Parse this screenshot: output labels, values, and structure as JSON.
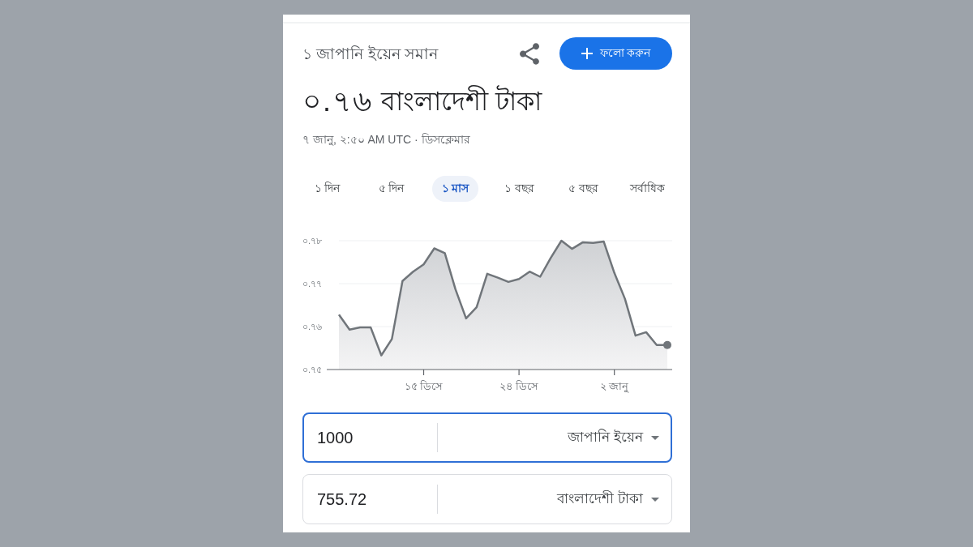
{
  "header": {
    "subtitle": "১ জাপানি ইয়েন সমান",
    "follow_button": {
      "label": "ফলো করুন"
    }
  },
  "rate": {
    "value": "০.৭৬",
    "currency": "বাংলাদেশী টাকা"
  },
  "timestamp": "৭ জানু, ২:৫০ AM UTC ·",
  "disclaimer_link": "ডিসক্লেমার",
  "tabs": [
    {
      "label": "১ দিন",
      "selected": false
    },
    {
      "label": "৫ দিন",
      "selected": false
    },
    {
      "label": "১ মাস",
      "selected": true
    },
    {
      "label": "১ বছর",
      "selected": false
    },
    {
      "label": "৫ বছর",
      "selected": false
    },
    {
      "label": "সর্বাধিক",
      "selected": false
    }
  ],
  "chart_data": {
    "type": "area",
    "categories": [
      null,
      null,
      null,
      null,
      null,
      null,
      null,
      null,
      "১৫ ডিসে",
      null,
      null,
      null,
      null,
      null,
      null,
      null,
      null,
      "২৪ ডিসে",
      null,
      null,
      null,
      null,
      null,
      null,
      null,
      null,
      "২ জানু",
      null,
      null,
      null,
      null,
      null
    ],
    "values": [
      0.7628,
      0.7593,
      0.7598,
      0.7598,
      0.7533,
      0.7571,
      0.7706,
      0.7728,
      0.7745,
      0.7782,
      0.7771,
      0.7687,
      0.7619,
      0.7645,
      0.7723,
      0.7714,
      0.7704,
      0.7711,
      0.7728,
      0.7716,
      0.776,
      0.78,
      0.7781,
      0.7796,
      0.7795,
      0.7798,
      0.7725,
      0.7665,
      0.7579,
      0.7587,
      0.7557,
      0.7557
    ],
    "ylim": [
      0.75,
      0.78
    ],
    "yticks": [
      {
        "value": 0.78,
        "label": "০.৭৮"
      },
      {
        "value": 0.77,
        "label": "০.৭৭"
      },
      {
        "value": 0.76,
        "label": "০.৭৬"
      },
      {
        "value": 0.75,
        "label": "০.৭৫"
      }
    ]
  },
  "converter": [
    {
      "amount": "1000",
      "currency": "জাপানি ইয়েন",
      "focused": true
    },
    {
      "amount": "755.72",
      "currency": "বাংলাদেশী টাকা",
      "focused": false
    }
  ]
}
